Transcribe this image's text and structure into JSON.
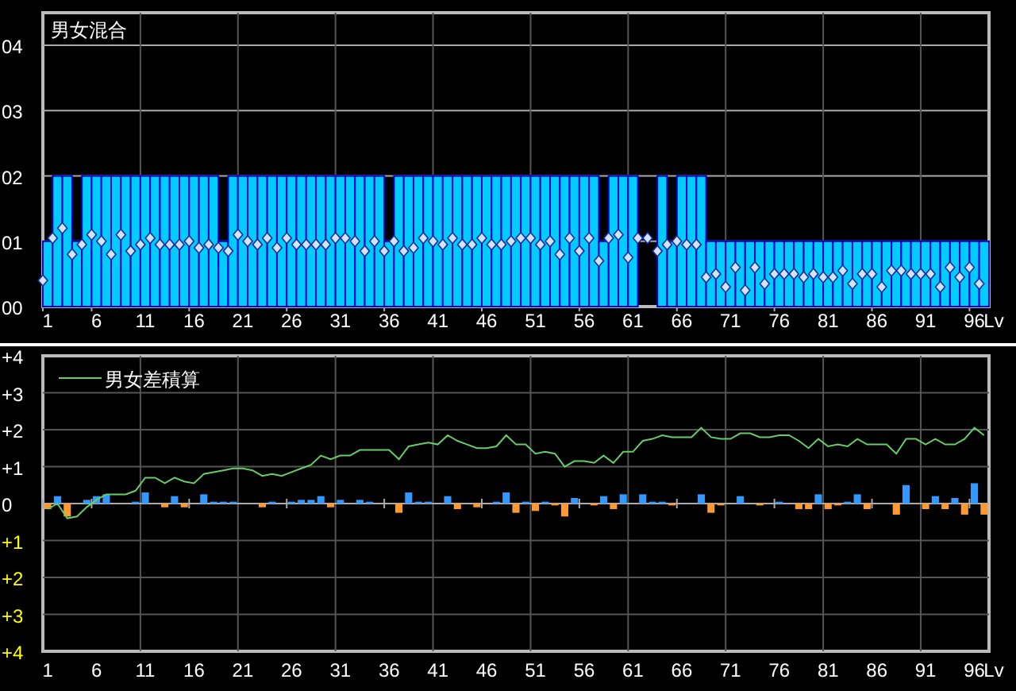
{
  "top_chart": {
    "chart_data": {
      "type": "bar",
      "title": "男女混合",
      "xlabel": "Lv",
      "grid": true,
      "x": [
        1,
        2,
        3,
        4,
        5,
        6,
        7,
        8,
        9,
        10,
        11,
        12,
        13,
        14,
        15,
        16,
        17,
        18,
        19,
        20,
        21,
        22,
        23,
        24,
        25,
        26,
        27,
        28,
        29,
        30,
        31,
        32,
        33,
        34,
        35,
        36,
        37,
        38,
        39,
        40,
        41,
        42,
        43,
        44,
        45,
        46,
        47,
        48,
        49,
        50,
        51,
        52,
        53,
        54,
        55,
        56,
        57,
        58,
        59,
        60,
        61,
        62,
        63,
        64,
        65,
        66,
        67,
        68,
        69,
        70,
        71,
        72,
        73,
        74,
        75,
        76,
        77,
        78,
        79,
        80,
        81,
        82,
        83,
        84,
        85,
        86,
        87,
        88,
        89,
        90,
        91,
        92,
        93,
        94,
        95,
        96,
        97
      ],
      "xlim": [
        0.5,
        97.5
      ],
      "ylim": [
        0,
        4.5
      ],
      "xticks": [
        1,
        6,
        11,
        16,
        21,
        26,
        31,
        36,
        41,
        46,
        51,
        56,
        61,
        66,
        71,
        76,
        81,
        86,
        91,
        96
      ],
      "yticks": [
        {
          "value": 0,
          "label": "00"
        },
        {
          "value": 1,
          "label": "01"
        },
        {
          "value": 2,
          "label": "02"
        },
        {
          "value": 3,
          "label": "03"
        },
        {
          "value": 4,
          "label": "04"
        }
      ],
      "series": [
        {
          "color": "#00ccff",
          "values": [
            1,
            2,
            2,
            1,
            2,
            2,
            2,
            2,
            2,
            2,
            2,
            2,
            2,
            2,
            2,
            2,
            2,
            2,
            1,
            2,
            2,
            2,
            2,
            2,
            2,
            2,
            2,
            2,
            2,
            2,
            2,
            2,
            2,
            2,
            2,
            1,
            2,
            2,
            2,
            2,
            2,
            2,
            2,
            2,
            2,
            2,
            2,
            2,
            2,
            2,
            2,
            2,
            2,
            2,
            2,
            2,
            2,
            1,
            2,
            2,
            2,
            0,
            0,
            2,
            1,
            2,
            2,
            2,
            1,
            1,
            1,
            1,
            1,
            1,
            1,
            1,
            1,
            1,
            1,
            1,
            1,
            1,
            1,
            1,
            1,
            1,
            1,
            1,
            1,
            1,
            1,
            1,
            1,
            1,
            1,
            1,
            1
          ]
        },
        {
          "type": "scatter",
          "color": "#d0e4ff",
          "values": [
            0.4,
            1.05,
            1.2,
            0.8,
            0.95,
            1.1,
            1.0,
            0.8,
            1.1,
            0.85,
            0.95,
            1.05,
            0.95,
            0.95,
            0.95,
            1.0,
            0.9,
            0.95,
            0.9,
            0.85,
            1.1,
            1.0,
            0.95,
            1.05,
            0.9,
            1.05,
            0.95,
            0.95,
            0.95,
            0.95,
            1.05,
            1.05,
            1.0,
            0.85,
            1.0,
            0.85,
            1.0,
            0.85,
            0.9,
            1.05,
            1.0,
            0.95,
            1.05,
            0.95,
            0.95,
            1.05,
            0.95,
            0.95,
            1.0,
            1.05,
            1.05,
            0.95,
            1.0,
            0.8,
            1.05,
            0.85,
            1.05,
            0.7,
            1.05,
            1.1,
            0.75,
            1.05,
            1.05,
            0.85,
            0.95,
            1.0,
            0.95,
            0.95,
            0.45,
            0.5,
            0.3,
            0.6,
            0.25,
            0.6,
            0.35,
            0.5,
            0.5,
            0.5,
            0.45,
            0.5,
            0.45,
            0.45,
            0.55,
            0.35,
            0.5,
            0.5,
            0.3,
            0.55,
            0.55,
            0.5,
            0.5,
            0.5,
            0.3,
            0.6,
            0.45,
            0.6,
            0.35
          ]
        }
      ]
    }
  },
  "bottom_chart": {
    "chart_data": {
      "type": "bar",
      "xlabel": "Lv",
      "grid": true,
      "stacked": true,
      "x": [
        1,
        2,
        3,
        4,
        5,
        6,
        7,
        8,
        9,
        10,
        11,
        12,
        13,
        14,
        15,
        16,
        17,
        18,
        19,
        20,
        21,
        22,
        23,
        24,
        25,
        26,
        27,
        28,
        29,
        30,
        31,
        32,
        33,
        34,
        35,
        36,
        37,
        38,
        39,
        40,
        41,
        42,
        43,
        44,
        45,
        46,
        47,
        48,
        49,
        50,
        51,
        52,
        53,
        54,
        55,
        56,
        57,
        58,
        59,
        60,
        61,
        62,
        63,
        64,
        65,
        66,
        67,
        68,
        69,
        70,
        71,
        72,
        73,
        74,
        75,
        76,
        77,
        78,
        79,
        80,
        81,
        82,
        83,
        84,
        85,
        86,
        87,
        88,
        89,
        90,
        91,
        92,
        93,
        94,
        95,
        96,
        97
      ],
      "xlim": [
        0.5,
        97.5
      ],
      "ylim": [
        -4,
        4
      ],
      "xticks": [
        1,
        6,
        11,
        16,
        21,
        26,
        31,
        36,
        41,
        46,
        51,
        56,
        61,
        66,
        71,
        76,
        81,
        86,
        91,
        96
      ],
      "yticks": [
        {
          "value": 4,
          "label": "+4"
        },
        {
          "value": 3,
          "label": "+3"
        },
        {
          "value": 2,
          "label": "+2"
        },
        {
          "value": 1,
          "label": "+1"
        },
        {
          "value": 0,
          "label": "0"
        },
        {
          "value": -1,
          "label": "+1"
        },
        {
          "value": -2,
          "label": "+2"
        },
        {
          "value": -3,
          "label": "+3"
        },
        {
          "value": -4,
          "label": "+4"
        }
      ],
      "series": [
        {
          "color": "#3399ff",
          "values": [
            null,
            0.2,
            null,
            null,
            0.1,
            0.2,
            0.25,
            null,
            null,
            0.05,
            0.3,
            null,
            null,
            0.2,
            null,
            null,
            0.25,
            0.05,
            0.05,
            0.05,
            null,
            null,
            null,
            0.05,
            null,
            0.05,
            0.1,
            0.1,
            0.2,
            null,
            0.1,
            null,
            0.1,
            0.05,
            null,
            null,
            null,
            0.3,
            0.05,
            0.05,
            null,
            0.2,
            null,
            null,
            null,
            null,
            0.05,
            0.3,
            null,
            0.05,
            null,
            0.05,
            null,
            null,
            0.15,
            null,
            null,
            0.2,
            null,
            0.25,
            null,
            0.25,
            0.05,
            0.05,
            null,
            null,
            null,
            0.25,
            null,
            null,
            null,
            0.2,
            null,
            null,
            null,
            0.05,
            null,
            null,
            null,
            0.25,
            null,
            null,
            0.05,
            0.25,
            null,
            null,
            null,
            null,
            0.5,
            null,
            null,
            0.2,
            null,
            0.15,
            null,
            0.55,
            null
          ]
        },
        {
          "color": "#ff9933",
          "values": [
            -0.15,
            null,
            -0.35,
            null,
            null,
            null,
            null,
            null,
            null,
            null,
            null,
            null,
            -0.1,
            null,
            -0.1,
            null,
            null,
            null,
            null,
            null,
            null,
            null,
            -0.1,
            null,
            null,
            null,
            null,
            null,
            null,
            -0.1,
            null,
            null,
            null,
            null,
            null,
            null,
            -0.25,
            null,
            null,
            null,
            null,
            null,
            -0.15,
            null,
            -0.1,
            null,
            null,
            null,
            -0.25,
            null,
            -0.2,
            null,
            -0.05,
            -0.35,
            null,
            null,
            -0.05,
            null,
            -0.15,
            null,
            null,
            null,
            null,
            null,
            -0.05,
            null,
            null,
            null,
            -0.25,
            -0.05,
            null,
            null,
            null,
            -0.05,
            null,
            null,
            null,
            -0.15,
            -0.15,
            null,
            -0.15,
            -0.05,
            null,
            null,
            -0.15,
            null,
            null,
            -0.3,
            null,
            null,
            -0.15,
            null,
            -0.15,
            null,
            -0.3,
            null,
            -0.3
          ]
        },
        {
          "type": "line",
          "name": "男女差積算",
          "color": "#66cc66",
          "values": [
            -0.15,
            0,
            -0.4,
            -0.35,
            -0.1,
            0.1,
            0.25,
            0.25,
            0.25,
            0.35,
            0.7,
            0.7,
            0.55,
            0.7,
            0.6,
            0.55,
            0.8,
            0.85,
            0.9,
            0.95,
            0.95,
            0.9,
            0.75,
            0.8,
            0.75,
            0.85,
            0.95,
            1.05,
            1.3,
            1.2,
            1.3,
            1.3,
            1.45,
            1.45,
            1.45,
            1.45,
            1.2,
            1.55,
            1.6,
            1.65,
            1.6,
            1.85,
            1.7,
            1.6,
            1.5,
            1.5,
            1.55,
            1.85,
            1.6,
            1.6,
            1.35,
            1.4,
            1.35,
            1.0,
            1.15,
            1.15,
            1.1,
            1.3,
            1.1,
            1.4,
            1.4,
            1.7,
            1.75,
            1.85,
            1.8,
            1.8,
            1.8,
            2.05,
            1.8,
            1.75,
            1.75,
            1.9,
            1.9,
            1.8,
            1.8,
            1.85,
            1.85,
            1.7,
            1.5,
            1.75,
            1.55,
            1.6,
            1.55,
            1.75,
            1.6,
            1.6,
            1.6,
            1.35,
            1.75,
            1.75,
            1.6,
            1.75,
            1.6,
            1.6,
            1.75,
            2.05,
            1.85
          ]
        }
      ]
    }
  }
}
